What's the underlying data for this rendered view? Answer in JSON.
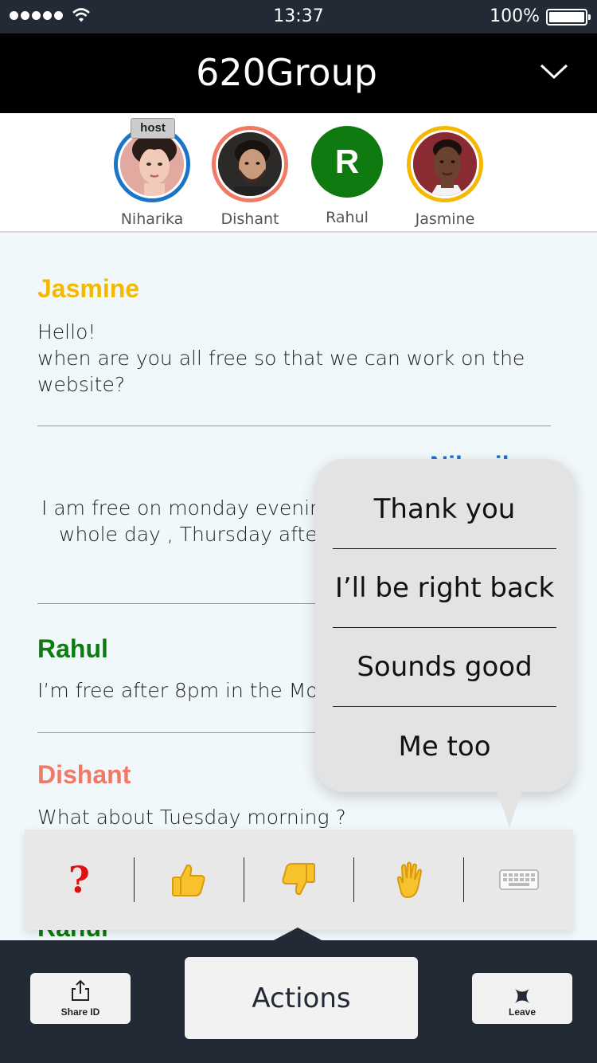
{
  "status_bar": {
    "time": "13:37",
    "battery": "100%"
  },
  "header": {
    "title": "620Group"
  },
  "participants": [
    {
      "name": "Niharika",
      "badge": "host",
      "ring_color": "#1a74c8",
      "avatar": "photo"
    },
    {
      "name": "Dishant",
      "ring_color": "#f07a65",
      "avatar": "photo"
    },
    {
      "name": "Rahul",
      "initial": "R",
      "color": "#0f7a0f",
      "avatar": "letter"
    },
    {
      "name": "Jasmine",
      "ring_color": "#f5b800",
      "avatar": "photo"
    }
  ],
  "messages": [
    {
      "sender": "Jasmine",
      "color": "#f5b800",
      "lines": [
        "Hello!",
        "when are you all free so that we can work on the",
        "website?"
      ]
    },
    {
      "sender": "Niharika",
      "color": "#1a74c8",
      "lines": [
        "I am free on monday evening",
        "whole day , Thursday after"
      ]
    },
    {
      "sender": "Rahul",
      "color": "#0f7a0f",
      "lines": [
        "I’m free after 8pm in the Mon"
      ]
    },
    {
      "sender": "Dishant",
      "color": "#f07a65",
      "lines": [
        "What about Tuesday morning ?"
      ]
    },
    {
      "sender": "Rahul",
      "color": "#0f7a0f",
      "lines": []
    }
  ],
  "quick_replies": [
    "Thank you",
    "I’ll be right back",
    "Sounds good",
    "Me too"
  ],
  "reactions": [
    {
      "name": "question",
      "glyph": "❓"
    },
    {
      "name": "thumbs-up",
      "glyph": "👍"
    },
    {
      "name": "thumbs-down",
      "glyph": "👎"
    },
    {
      "name": "raised-hand",
      "glyph": "✋"
    },
    {
      "name": "keyboard",
      "glyph": "⌨"
    }
  ],
  "bottom_bar": {
    "share_label": "Share ID",
    "actions_label": "Actions",
    "leave_label": "Leave"
  }
}
